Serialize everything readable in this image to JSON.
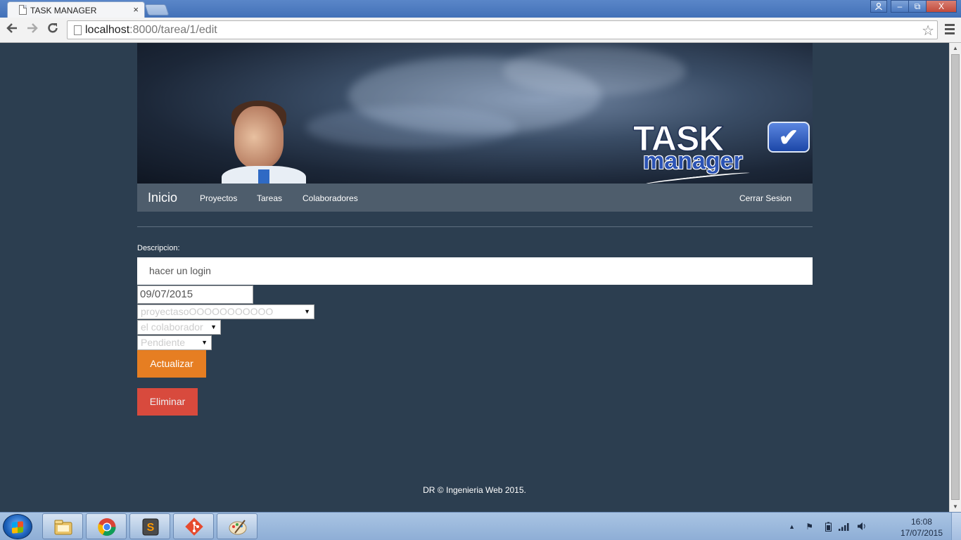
{
  "browser": {
    "tab_title": "TASK MANAGER",
    "tab_close": "×",
    "url_host": "localhost",
    "url_path": ":8000/tarea/1/edit"
  },
  "window_controls": {
    "minimize": "–",
    "restore": "⧉",
    "close": "X"
  },
  "navbar": {
    "brand": "Inicio",
    "links": [
      "Proyectos",
      "Tareas",
      "Colaboradores"
    ],
    "logout": "Cerrar Sesion"
  },
  "banner": {
    "logo_title": "TASK",
    "logo_subtitle": "manager"
  },
  "form": {
    "descripcion_label": "Descripcion:",
    "descripcion_value": "hacer un login",
    "fecha_value": "09/07/2015",
    "proyecto_selected": "proyectasoOOOOOOOOOOO",
    "colaborador_selected": "el colaborador",
    "estado_selected": "Pendiente",
    "update_button": "Actualizar",
    "delete_button": "Eliminar"
  },
  "footer": {
    "text": "DR © Ingenieria Web 2015."
  },
  "taskbar": {
    "apps": [
      "file-explorer-icon",
      "chrome-icon",
      "sublime-text-icon",
      "git-icon",
      "paint-icon"
    ],
    "time": "16:08",
    "date": "17/07/2015"
  },
  "colors": {
    "page_bg": "#2c3e50",
    "navbar_bg": "#4e5d6c",
    "update_btn": "#e67e22",
    "delete_btn": "#e74c3c"
  }
}
